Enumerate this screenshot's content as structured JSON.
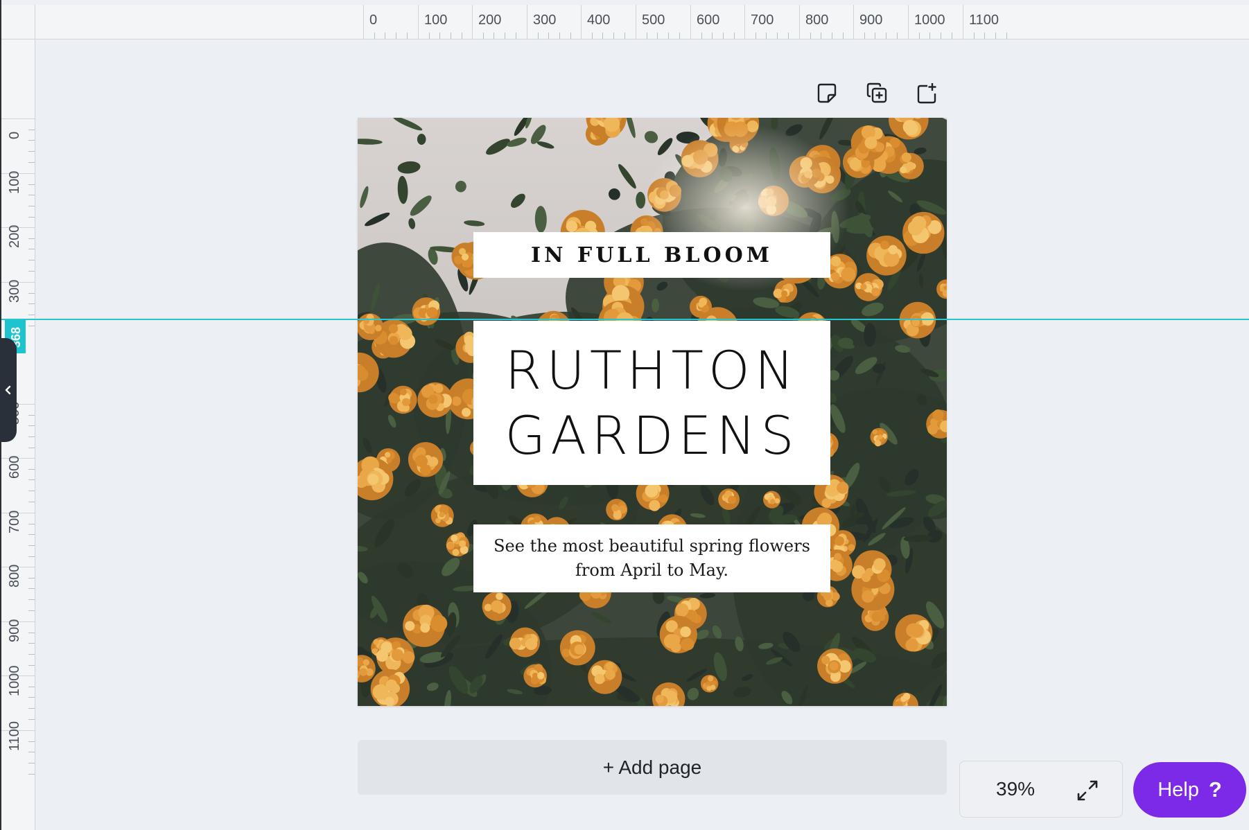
{
  "ruler": {
    "horizontal_labels": [
      "0",
      "100",
      "200",
      "300",
      "400",
      "500",
      "600",
      "700",
      "800",
      "900",
      "1000",
      "1100"
    ],
    "vertical_labels": [
      "0",
      "100",
      "200",
      "300",
      "500",
      "600",
      "700",
      "800",
      "900",
      "1000",
      "1100"
    ],
    "guide_position": "368"
  },
  "toolbar": {
    "note_icon": "sticky-note-icon",
    "duplicate_icon": "duplicate-page-icon",
    "add_icon": "add-page-icon"
  },
  "design": {
    "tagline": "IN FULL BLOOM",
    "title_line1": "RUTHTON",
    "title_line2": "GARDENS",
    "subtitle_line1": "See the most beautiful spring flowers",
    "subtitle_line2": "from April to May.",
    "background": "orange-lantana-flowers-photo"
  },
  "canvas_actions": {
    "add_page_label": "+ Add page"
  },
  "zoom": {
    "value": "39%",
    "expand_icon": "expand-arrows-icon"
  },
  "help": {
    "label": "Help",
    "icon": "?"
  },
  "colors": {
    "guide": "#27c6d1",
    "help_button": "#7d2ae8",
    "canvas_bg": "#eceff3"
  }
}
